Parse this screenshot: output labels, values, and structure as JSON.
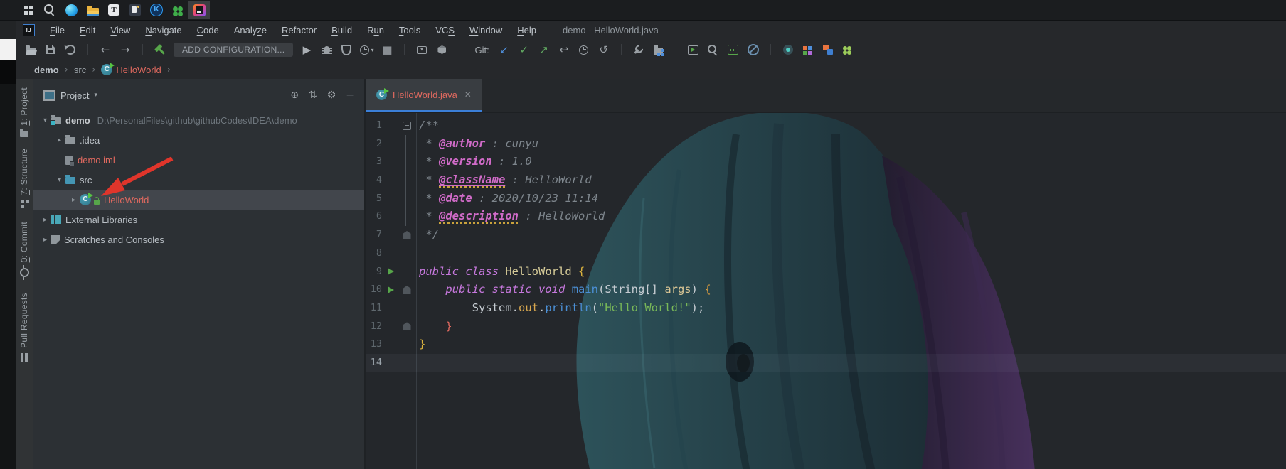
{
  "colors": {
    "accent_blue": "#3b7fd8",
    "selection": "#42464c",
    "error_red": "#e0695f",
    "run_green": "#57a64a",
    "annotation_red": "#e0352b"
  },
  "taskbar": {
    "apps": [
      {
        "name": "windows-start",
        "shape": "start"
      },
      {
        "name": "windows-search",
        "shape": "tbsearch"
      },
      {
        "name": "edge-browser",
        "shape": "edge"
      },
      {
        "name": "file-explorer",
        "shape": "tbfolder"
      },
      {
        "name": "typora",
        "shape": "typora"
      },
      {
        "name": "snipaste",
        "shape": "snip"
      },
      {
        "name": "kite",
        "shape": "kite"
      },
      {
        "name": "clover",
        "shape": "clover"
      },
      {
        "name": "intellij-idea",
        "shape": "idea",
        "active": true
      }
    ]
  },
  "menu": {
    "logo": "IJ",
    "title": "demo - HelloWorld.java",
    "items": [
      {
        "label": "File",
        "u": 0
      },
      {
        "label": "Edit",
        "u": 0
      },
      {
        "label": "View",
        "u": 0
      },
      {
        "label": "Navigate",
        "u": 0
      },
      {
        "label": "Code",
        "u": 0
      },
      {
        "label": "Analyze",
        "u": 5
      },
      {
        "label": "Refactor",
        "u": 0
      },
      {
        "label": "Build",
        "u": 0
      },
      {
        "label": "Run",
        "u": 1
      },
      {
        "label": "Tools",
        "u": 0
      },
      {
        "label": "VCS",
        "u": 2
      },
      {
        "label": "Window",
        "u": 0
      },
      {
        "label": "Help",
        "u": 0
      }
    ]
  },
  "toolbar": {
    "items": [
      {
        "name": "open-file-icon",
        "shape": "open"
      },
      {
        "name": "save-all-icon",
        "shape": "save"
      },
      {
        "name": "sync-icon",
        "shape": "sync"
      },
      {
        "sep": true
      },
      {
        "name": "back-icon",
        "glyph": "←"
      },
      {
        "name": "forward-icon",
        "glyph": "→"
      },
      {
        "sep": true
      },
      {
        "name": "build-hammer-icon",
        "shape": "hammer"
      },
      {
        "name": "add-configuration-button",
        "button": true,
        "label": "ADD CONFIGURATION..."
      },
      {
        "name": "run-icon",
        "glyph": "▶",
        "color": "#a9aeb3"
      },
      {
        "name": "debug-icon",
        "shape": "bug"
      },
      {
        "name": "coverage-icon",
        "shape": "shield"
      },
      {
        "name": "profiler-icon",
        "shape": "clock",
        "caret": true
      },
      {
        "name": "stop-icon",
        "glyph": "■",
        "color": "#898e93"
      },
      {
        "sep": true
      },
      {
        "name": "attach-process-icon",
        "shape": "attach"
      },
      {
        "name": "build-artifact-icon",
        "shape": "package"
      },
      {
        "sep": true
      },
      {
        "name": "git-label",
        "label": "Git:"
      },
      {
        "name": "git-update-icon",
        "glyph": "↙",
        "color": "#4f8fdb"
      },
      {
        "name": "git-commit-icon",
        "glyph": "✓",
        "color": "#61a861"
      },
      {
        "name": "git-push-icon",
        "glyph": "↗",
        "color": "#61a861"
      },
      {
        "name": "git-rollback-icon",
        "glyph": "↩",
        "color": "#9aa0a5"
      },
      {
        "name": "git-history-icon",
        "shape": "clock"
      },
      {
        "name": "git-undo-icon",
        "glyph": "↺",
        "color": "#9aa0a5"
      },
      {
        "sep": true
      },
      {
        "name": "settings-wrench-icon",
        "shape": "wrench"
      },
      {
        "name": "project-structure-icon",
        "shape": "structfolder"
      },
      {
        "sep": true
      },
      {
        "name": "run-anything-icon",
        "shape": "runwin"
      },
      {
        "name": "search-everywhere-icon",
        "shape": "magnifier"
      },
      {
        "name": "wave-plugin-icon",
        "shape": "wavebox"
      },
      {
        "name": "power-save-icon",
        "shape": "blocked"
      },
      {
        "sep": true
      },
      {
        "name": "record-plugin-icon",
        "shape": "record"
      },
      {
        "name": "grid-plugin-icon",
        "shape": "grid"
      },
      {
        "name": "translation-plugin-icon",
        "shape": "translate"
      },
      {
        "name": "plugin-clover-icon",
        "shape": "puzzle"
      }
    ]
  },
  "breadcrumb": {
    "separator": "›",
    "items": [
      {
        "label": "demo",
        "cls": "bold"
      },
      {
        "label": "src"
      },
      {
        "label": "HelloWorld",
        "cls": "classref",
        "icon": true
      }
    ]
  },
  "stripes": {
    "left": [
      {
        "label": "1: Project",
        "u": 0,
        "icon": "sfolder",
        "mt": 12
      },
      {
        "label": "7: Structure",
        "u": 0,
        "icon": "sstruct",
        "mt": 16
      },
      {
        "label": "0: Commit",
        "u": 0,
        "icon": "scommit",
        "mt": 20
      },
      {
        "label": "Pull Requests",
        "icon": "spr",
        "mt": 22
      }
    ]
  },
  "project_panel": {
    "title": "Project",
    "caret": "▾",
    "header_icons": [
      {
        "name": "locate-button",
        "glyph": "⊕"
      },
      {
        "name": "collapse-all-button",
        "glyph": "⇅"
      },
      {
        "name": "settings-gear-button",
        "glyph": "⚙"
      },
      {
        "name": "hide-panel-button",
        "glyph": "−"
      }
    ],
    "chevrons": {
      "open": "▾",
      "closed": "▸"
    },
    "tree": [
      {
        "label": "demo",
        "path": "D:\\PersonalFiles\\github\\githubCodes\\IDEA\\demo",
        "icon": "folder-project",
        "chevron": "open",
        "level": 0,
        "bold": true
      },
      {
        "label": ".idea",
        "icon": "folder",
        "chevron": "closed",
        "level": 1
      },
      {
        "label": "demo.iml",
        "icon": "iml-file",
        "level": 1,
        "color": "red"
      },
      {
        "label": "src",
        "icon": "folder-src",
        "chevron": "open",
        "level": 1
      },
      {
        "label": "HelloWorld",
        "icon": "class",
        "chevron": "closed",
        "level": 2,
        "color": "red",
        "selected": true
      },
      {
        "label": "External Libraries",
        "icon": "libraries",
        "chevron": "closed",
        "level": 0
      },
      {
        "label": "Scratches and Consoles",
        "icon": "scratches",
        "chevron": "closed",
        "level": 0
      }
    ]
  },
  "editor": {
    "tab": {
      "label": "HelloWorld.java",
      "close_glyph": "✕"
    },
    "code": {
      "lines": [
        {
          "n": "1",
          "fold": "collapse",
          "tokens": [
            {
              "t": "/**",
              "c": "cmt"
            }
          ]
        },
        {
          "n": "2",
          "tokens": [
            {
              "t": " * ",
              "c": "cmt"
            },
            {
              "t": "@author",
              "c": "tag"
            },
            {
              "t": " : ",
              "c": "cmt"
            },
            {
              "t": "cunyu",
              "c": "cmtv"
            }
          ]
        },
        {
          "n": "3",
          "tokens": [
            {
              "t": " * ",
              "c": "cmt"
            },
            {
              "t": "@version",
              "c": "tag"
            },
            {
              "t": " : ",
              "c": "cmt"
            },
            {
              "t": "1.0",
              "c": "cmtv"
            }
          ]
        },
        {
          "n": "4",
          "tokens": [
            {
              "t": " * ",
              "c": "cmt"
            },
            {
              "t": "@className",
              "c": "tag sq"
            },
            {
              "t": " : ",
              "c": "cmt"
            },
            {
              "t": "HelloWorld",
              "c": "cmtv"
            }
          ]
        },
        {
          "n": "5",
          "tokens": [
            {
              "t": " * ",
              "c": "cmt"
            },
            {
              "t": "@date",
              "c": "tag"
            },
            {
              "t": " : ",
              "c": "cmt"
            },
            {
              "t": "2020/10/23 11:14",
              "c": "cmtv"
            }
          ]
        },
        {
          "n": "6",
          "tokens": [
            {
              "t": " * ",
              "c": "cmt"
            },
            {
              "t": "@description",
              "c": "tag sq"
            },
            {
              "t": " : ",
              "c": "cmt"
            },
            {
              "t": "HelloWorld",
              "c": "cmtv"
            }
          ]
        },
        {
          "n": "7",
          "fold": "end",
          "tokens": [
            {
              "t": " */",
              "c": "cmt"
            }
          ]
        },
        {
          "n": "8",
          "tokens": []
        },
        {
          "n": "9",
          "run": true,
          "tokens": [
            {
              "t": "public class ",
              "c": "kw"
            },
            {
              "t": "HelloWorld ",
              "c": "cls"
            },
            {
              "t": "{",
              "c": "br1"
            }
          ]
        },
        {
          "n": "10",
          "run": true,
          "fold": "end",
          "tokens": [
            {
              "t": "    ",
              "c": "pl"
            },
            {
              "t": "public static void ",
              "c": "kw"
            },
            {
              "t": "main",
              "c": "mtd"
            },
            {
              "t": "(",
              "c": "pl"
            },
            {
              "t": "String[] ",
              "c": "pl"
            },
            {
              "t": "args",
              "c": "arg"
            },
            {
              "t": ") ",
              "c": "pl"
            },
            {
              "t": "{",
              "c": "br2"
            }
          ]
        },
        {
          "n": "11",
          "tokens": [
            {
              "t": "        ",
              "c": "pl"
            },
            {
              "t": "System",
              "c": "pl"
            },
            {
              "t": ".",
              "c": "pl"
            },
            {
              "t": "out",
              "c": "fld"
            },
            {
              "t": ".",
              "c": "pl"
            },
            {
              "t": "println",
              "c": "mtd"
            },
            {
              "t": "(",
              "c": "pl"
            },
            {
              "t": "\"Hello World!\"",
              "c": "str"
            },
            {
              "t": ");",
              "c": "pl"
            }
          ]
        },
        {
          "n": "12",
          "fold": "end",
          "tokens": [
            {
              "t": "    ",
              "c": "pl"
            },
            {
              "t": "}",
              "c": "br2r"
            }
          ]
        },
        {
          "n": "13",
          "tokens": [
            {
              "t": "}",
              "c": "br1"
            }
          ]
        },
        {
          "n": "14",
          "caret": true,
          "tokens": []
        }
      ]
    }
  }
}
